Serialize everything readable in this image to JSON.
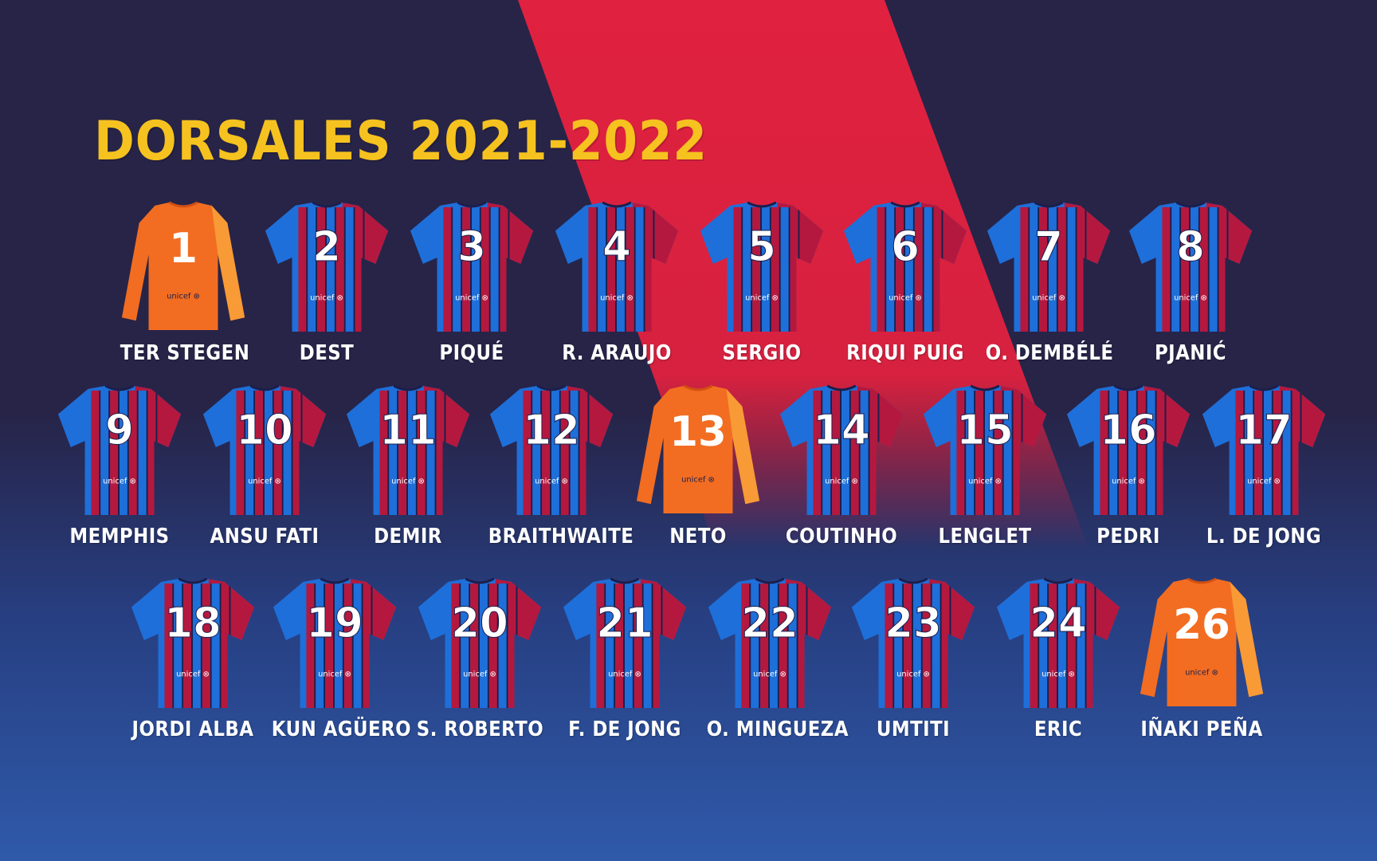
{
  "title": "DORSALES 2021-2022",
  "sponsor": "unicef",
  "colors": {
    "title": "#f6c21f",
    "stripe": "#e0213f",
    "blue": "#1e6fd9",
    "garnet": "#b5183e",
    "navy": "#1b1f4d",
    "keeper_orange": "#f26d21",
    "keeper_sleeve": "#f9a23a"
  },
  "players": [
    {
      "number": "1",
      "name": "TER STEGEN",
      "kit": "keeper"
    },
    {
      "number": "2",
      "name": "DEST",
      "kit": "field"
    },
    {
      "number": "3",
      "name": "PIQUÉ",
      "kit": "field"
    },
    {
      "number": "4",
      "name": "R. ARAUJO",
      "kit": "field"
    },
    {
      "number": "5",
      "name": "SERGIO",
      "kit": "field"
    },
    {
      "number": "6",
      "name": "RIQUI PUIG",
      "kit": "field"
    },
    {
      "number": "7",
      "name": "O. DEMBÉLÉ",
      "kit": "field"
    },
    {
      "number": "8",
      "name": "PJANIĆ",
      "kit": "field"
    },
    {
      "number": "9",
      "name": "MEMPHIS",
      "kit": "field"
    },
    {
      "number": "10",
      "name": "ANSU FATI",
      "kit": "field"
    },
    {
      "number": "11",
      "name": "DEMIR",
      "kit": "field"
    },
    {
      "number": "12",
      "name": "BRAITHWAITE",
      "kit": "field"
    },
    {
      "number": "13",
      "name": "NETO",
      "kit": "keeper"
    },
    {
      "number": "14",
      "name": "COUTINHO",
      "kit": "field"
    },
    {
      "number": "15",
      "name": "LENGLET",
      "kit": "field"
    },
    {
      "number": "16",
      "name": "PEDRI",
      "kit": "field"
    },
    {
      "number": "17",
      "name": "L. DE JONG",
      "kit": "field"
    },
    {
      "number": "18",
      "name": "JORDI ALBA",
      "kit": "field"
    },
    {
      "number": "19",
      "name": "KUN AGÜERO",
      "kit": "field"
    },
    {
      "number": "20",
      "name": "S. ROBERTO",
      "kit": "field"
    },
    {
      "number": "21",
      "name": "F. DE JONG",
      "kit": "field"
    },
    {
      "number": "22",
      "name": "O. MINGUEZA",
      "kit": "field"
    },
    {
      "number": "23",
      "name": "UMTITI",
      "kit": "field"
    },
    {
      "number": "24",
      "name": "ERIC",
      "kit": "field"
    },
    {
      "number": "26",
      "name": "IÑAKI PEÑA",
      "kit": "keeper"
    }
  ]
}
